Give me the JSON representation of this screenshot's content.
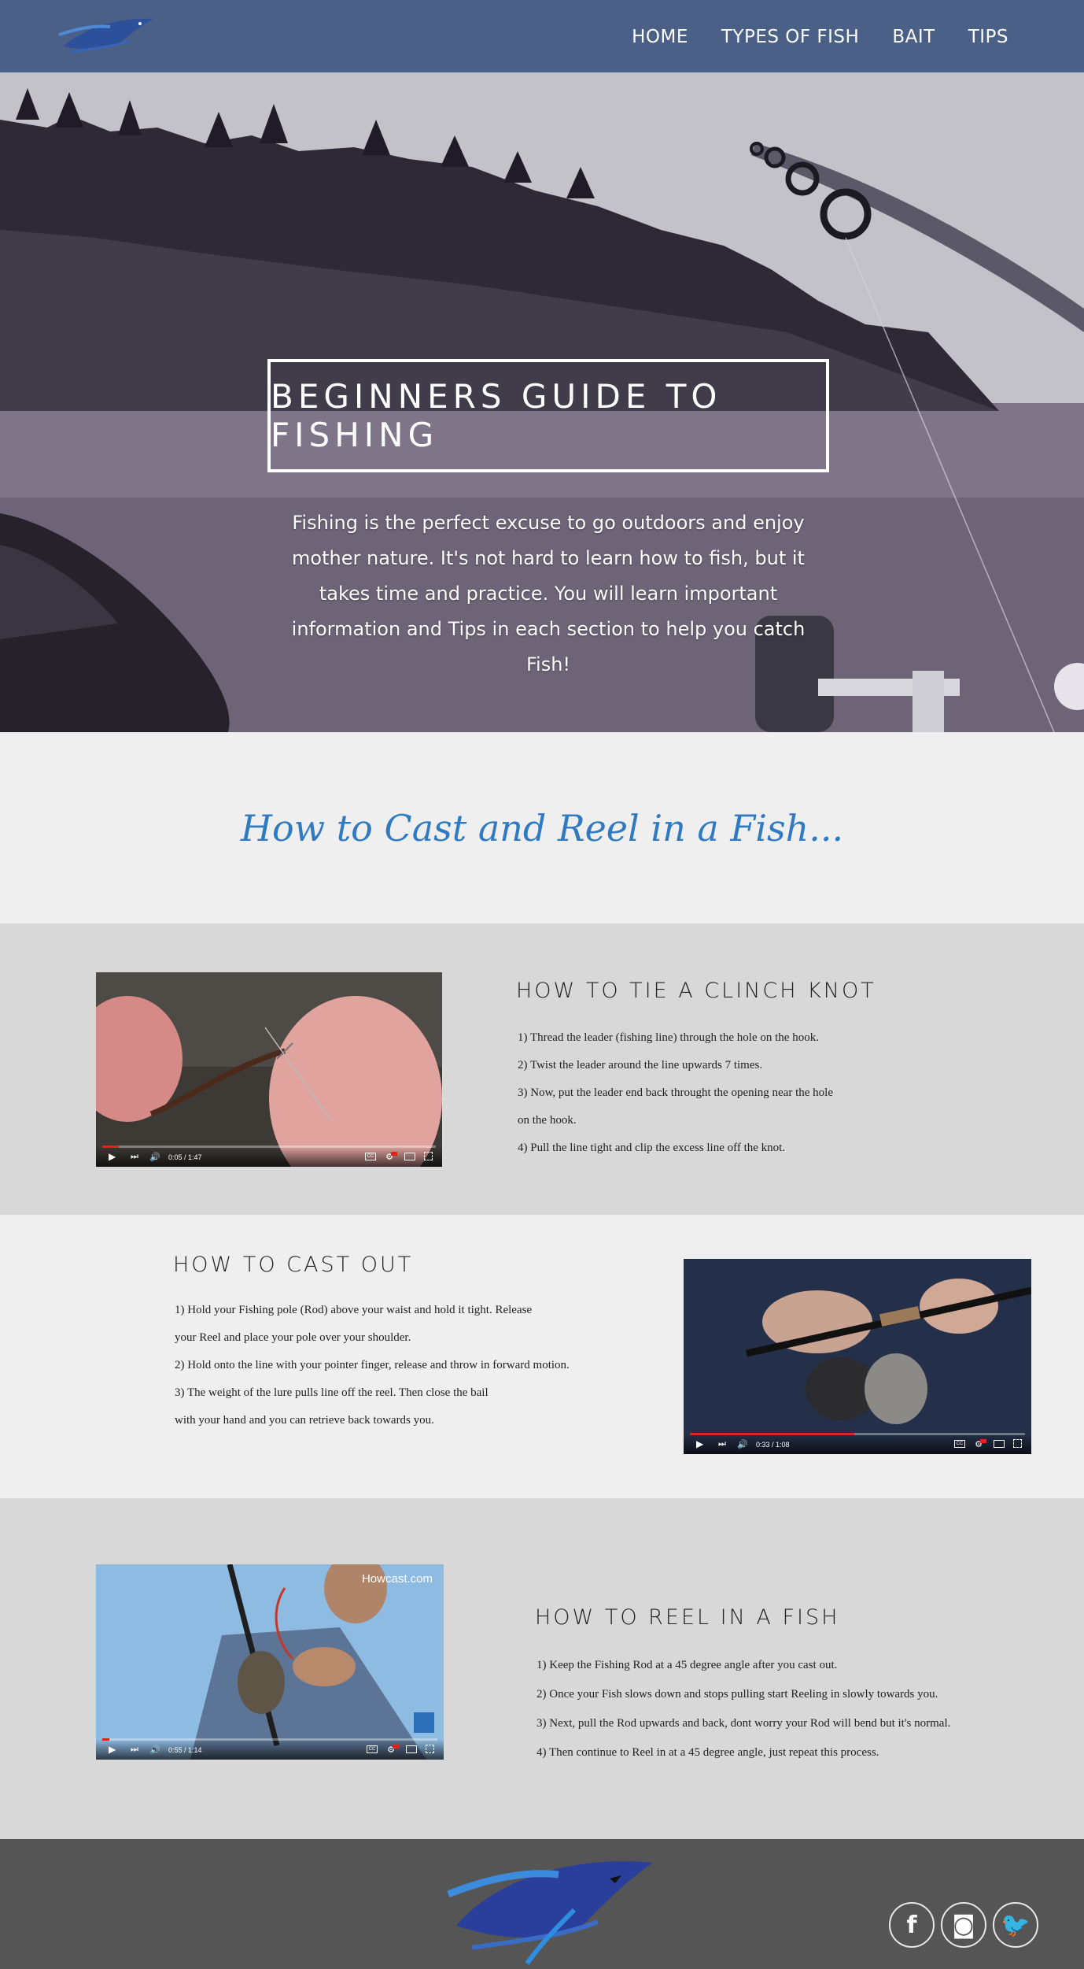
{
  "nav": {
    "items": [
      {
        "label": "HOME"
      },
      {
        "label": "TYPES OF FISH"
      },
      {
        "label": "BAIT"
      },
      {
        "label": "TIPS"
      }
    ]
  },
  "hero": {
    "title": "BEGINNERS GUIDE TO FISHING",
    "intro": "Fishing is the perfect excuse to go outdoors and enjoy mother nature. It's not hard to learn how to fish, but it takes time and practice. You will learn important information and Tips in each section to help you catch Fish!"
  },
  "cast_heading": "How to Cast and Reel in a Fish...",
  "sections": [
    {
      "title": "HOW TO TIE A CLINCH KNOT",
      "lines": [
        "1)  Thread the leader (fishing line) through the hole on the hook.",
        "2) Twist the leader around the line upwards 7 times.",
        "3) Now, put the leader end back throught the opening near the hole",
        "on the hook.",
        "4) Pull the line tight and clip the excess line off the knot."
      ],
      "video": {
        "time": "0:05 / 1:47",
        "progress": 0.05
      }
    },
    {
      "title": "HOW TO CAST OUT",
      "lines": [
        "1) Hold your Fishing pole (Rod) above your waist and hold it tight. Release",
        "your Reel and place your pole over your shoulder.",
        "2) Hold onto the line with your pointer finger, release and throw in forward motion.",
        "3) The weight of the lure pulls line off the reel. Then close the bail",
        "with your hand and you can retrieve back towards you."
      ],
      "video": {
        "time": "0:33 / 1:08",
        "progress": 0.49
      }
    },
    {
      "title": "HOW TO REEL IN A FISH",
      "lines": [
        "1)  Keep the Fishing Rod at a 45 degree angle after you cast out.",
        "2)  Once your Fish slows down and stops pulling start Reeling in slowly towards you.",
        "3) Next, pull the Rod upwards and back, dont worry your Rod will bend but it's normal.",
        "4) Then continue to Reel in at a 45 degree angle, just repeat this process."
      ],
      "video": {
        "time": "0:55 / 1:14",
        "progress": 0.02,
        "watermark": "Howcast.com"
      }
    }
  ],
  "footer": {
    "social": [
      {
        "icon": "facebook-icon",
        "glyph": "f"
      },
      {
        "icon": "instagram-icon",
        "glyph": "◙"
      },
      {
        "icon": "twitter-icon",
        "glyph": "🐦"
      }
    ]
  },
  "colors": {
    "nav": "#4b6087",
    "accent": "#2f7ac0",
    "section_gray": "#d8d8d8",
    "section_light": "#efefef",
    "footer": "#555555"
  }
}
